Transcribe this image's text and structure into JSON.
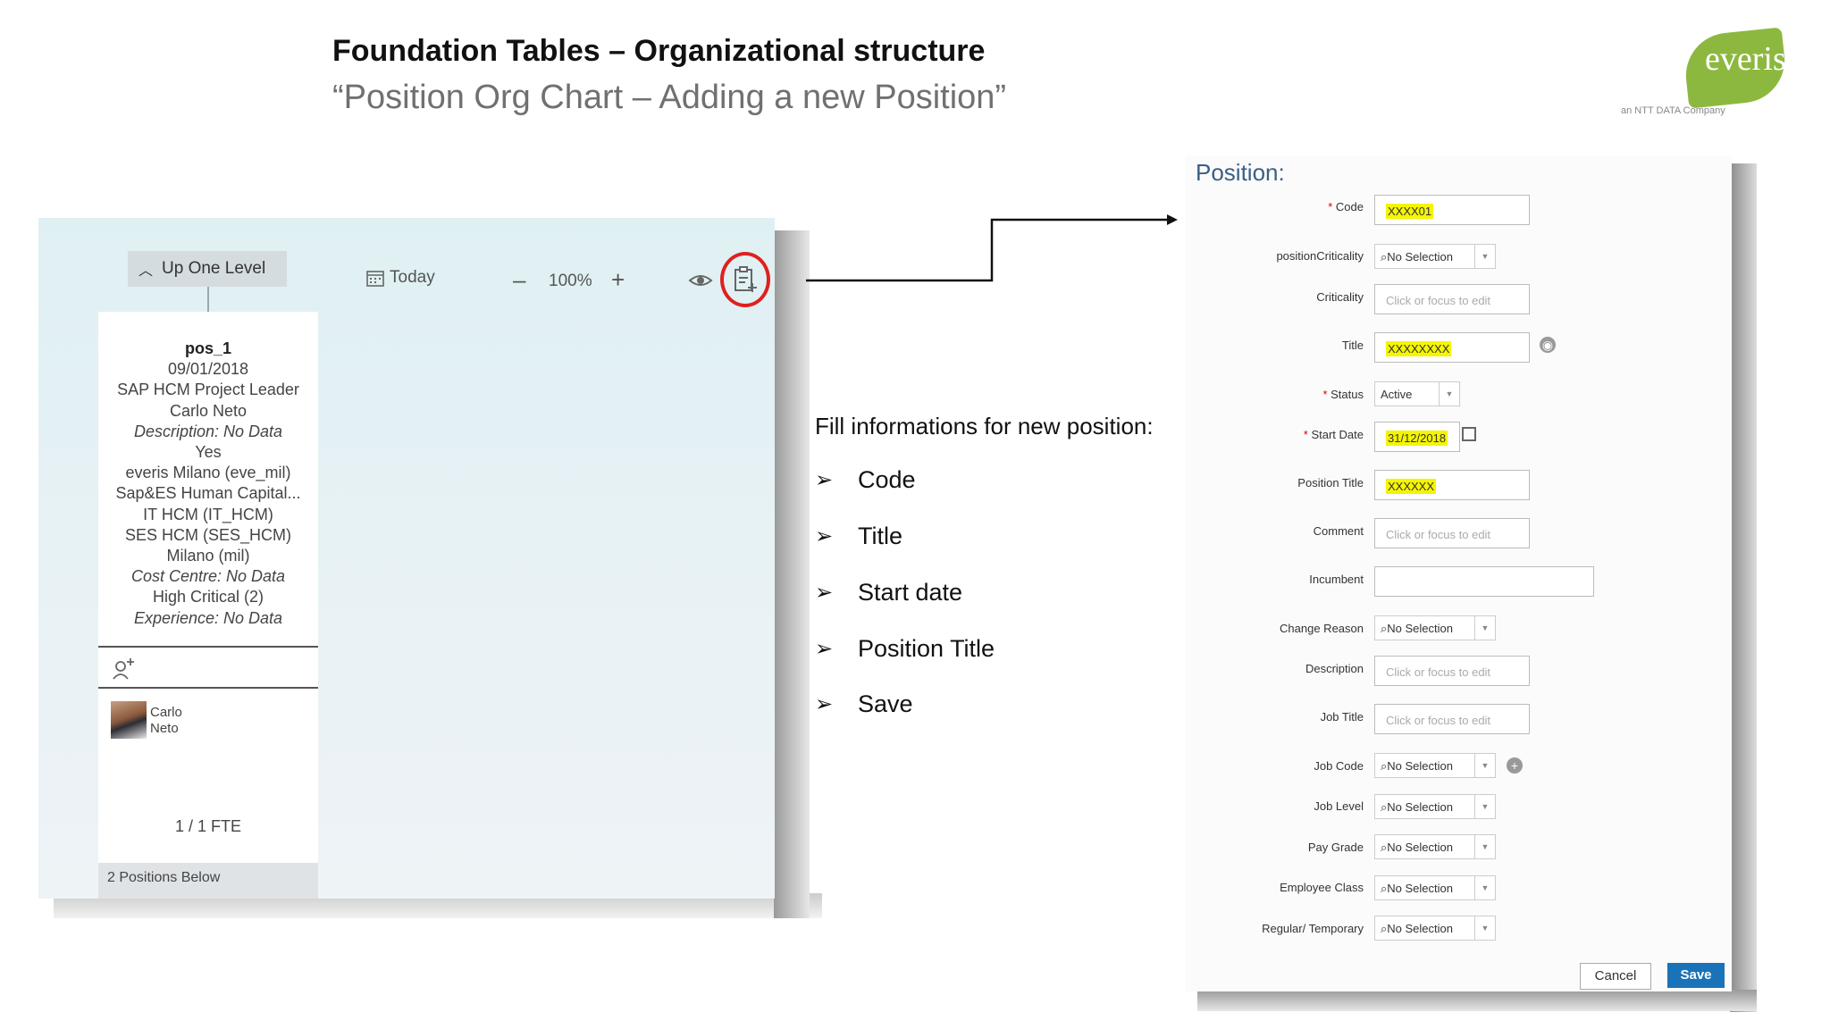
{
  "header": {
    "title": "Foundation Tables –  Organizational structure",
    "subtitle": "“Position Org Chart – Adding a new Position”"
  },
  "logo": {
    "text": "everis",
    "tagline": "an NTT DATA Company",
    "color": "#8db83f"
  },
  "org_chart": {
    "up_one_level": "Up One Level",
    "today": "Today",
    "zoom_minus": "–",
    "zoom": "100%",
    "zoom_plus": "+",
    "card": {
      "lines": [
        "pos_1",
        "09/01/2018",
        "SAP HCM Project Leader",
        "Carlo Neto",
        "Description: No Data",
        "Yes",
        "everis Milano (eve_mil)",
        "Sap&ES Human Capital...",
        "IT HCM (IT_HCM)",
        "SES HCM (SES_HCM)",
        "Milano (mil)",
        "Cost Centre: No Data",
        "High Critical (2)",
        "Experience: No Data"
      ],
      "incumbent_first": "Carlo",
      "incumbent_last": "Neto",
      "fte": "1 / 1 FTE",
      "positions_below": "2 Positions Below"
    }
  },
  "instructions": {
    "title": "Fill informations for new position:",
    "bullet": "➢",
    "items": [
      "Code",
      "Title",
      "Start date",
      "Position Title",
      "Save"
    ]
  },
  "form": {
    "header": "Position:",
    "required_mark": "*",
    "labels": {
      "code": "Code",
      "position_criticality": "positionCriticality",
      "criticality": "Criticality",
      "title": "Title",
      "status": "Status",
      "start_date": "Start Date",
      "position_title": "Position Title",
      "comment": "Comment",
      "incumbent": "Incumbent",
      "change_reason": "Change Reason",
      "description": "Description",
      "job_title": "Job Title",
      "job_code": "Job Code",
      "job_level": "Job Level",
      "pay_grade": "Pay Grade",
      "employee_class": "Employee Class",
      "regular_temporary": "Regular/ Temporary"
    },
    "values": {
      "code": "XXXX01",
      "title": "XXXXXXXX",
      "status": "Active",
      "start_date": "31/12/2018",
      "position_title": "XXXXXX"
    },
    "placeholder": "Click or focus to edit",
    "no_selection": "No Selection",
    "cancel": "Cancel",
    "save": "Save",
    "highlight_color": "#f5f500",
    "save_color": "#1a73b8"
  }
}
